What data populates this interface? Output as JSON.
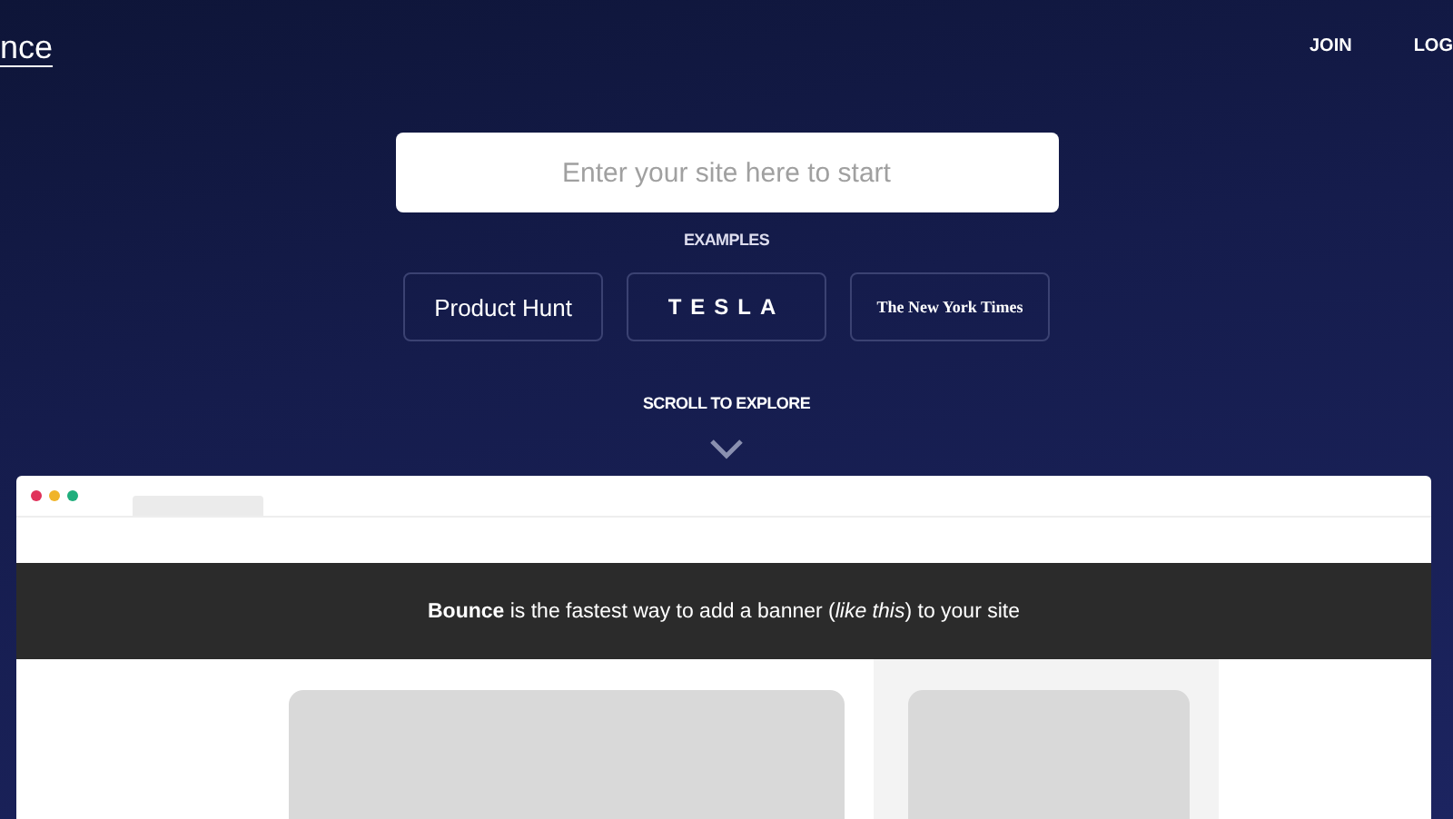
{
  "header": {
    "logo": "nce",
    "nav": [
      "JOIN",
      "LOG"
    ]
  },
  "search": {
    "placeholder": "Enter your site here to start"
  },
  "examples": {
    "label": "EXAMPLES",
    "items": [
      {
        "kind": "sans",
        "label": "Product Hunt"
      },
      {
        "kind": "spaced",
        "label": "TESLA"
      },
      {
        "kind": "serif",
        "label": "The New York Times"
      }
    ]
  },
  "scroll_hint": "SCROLL TO EXPLORE",
  "preview": {
    "banner": "**Bounce** is the fastest way to add a banner (*like this*) to your site"
  }
}
